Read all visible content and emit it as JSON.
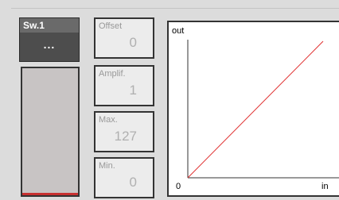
{
  "switch": {
    "title": "Sw.1",
    "menu_label": "...",
    "fill_fraction": 0.0
  },
  "params": [
    {
      "label": "Offset",
      "value": "0"
    },
    {
      "label": "Amplif.",
      "value": "1"
    },
    {
      "label": "Max.",
      "value": "127"
    },
    {
      "label": "Min.",
      "value": "0"
    }
  ],
  "graph": {
    "y_label": "out",
    "x_label": "in",
    "origin_label": "0",
    "line_color": "#e03030",
    "curve": {
      "type": "line",
      "x": [
        0,
        127
      ],
      "y": [
        0,
        127
      ]
    }
  }
}
